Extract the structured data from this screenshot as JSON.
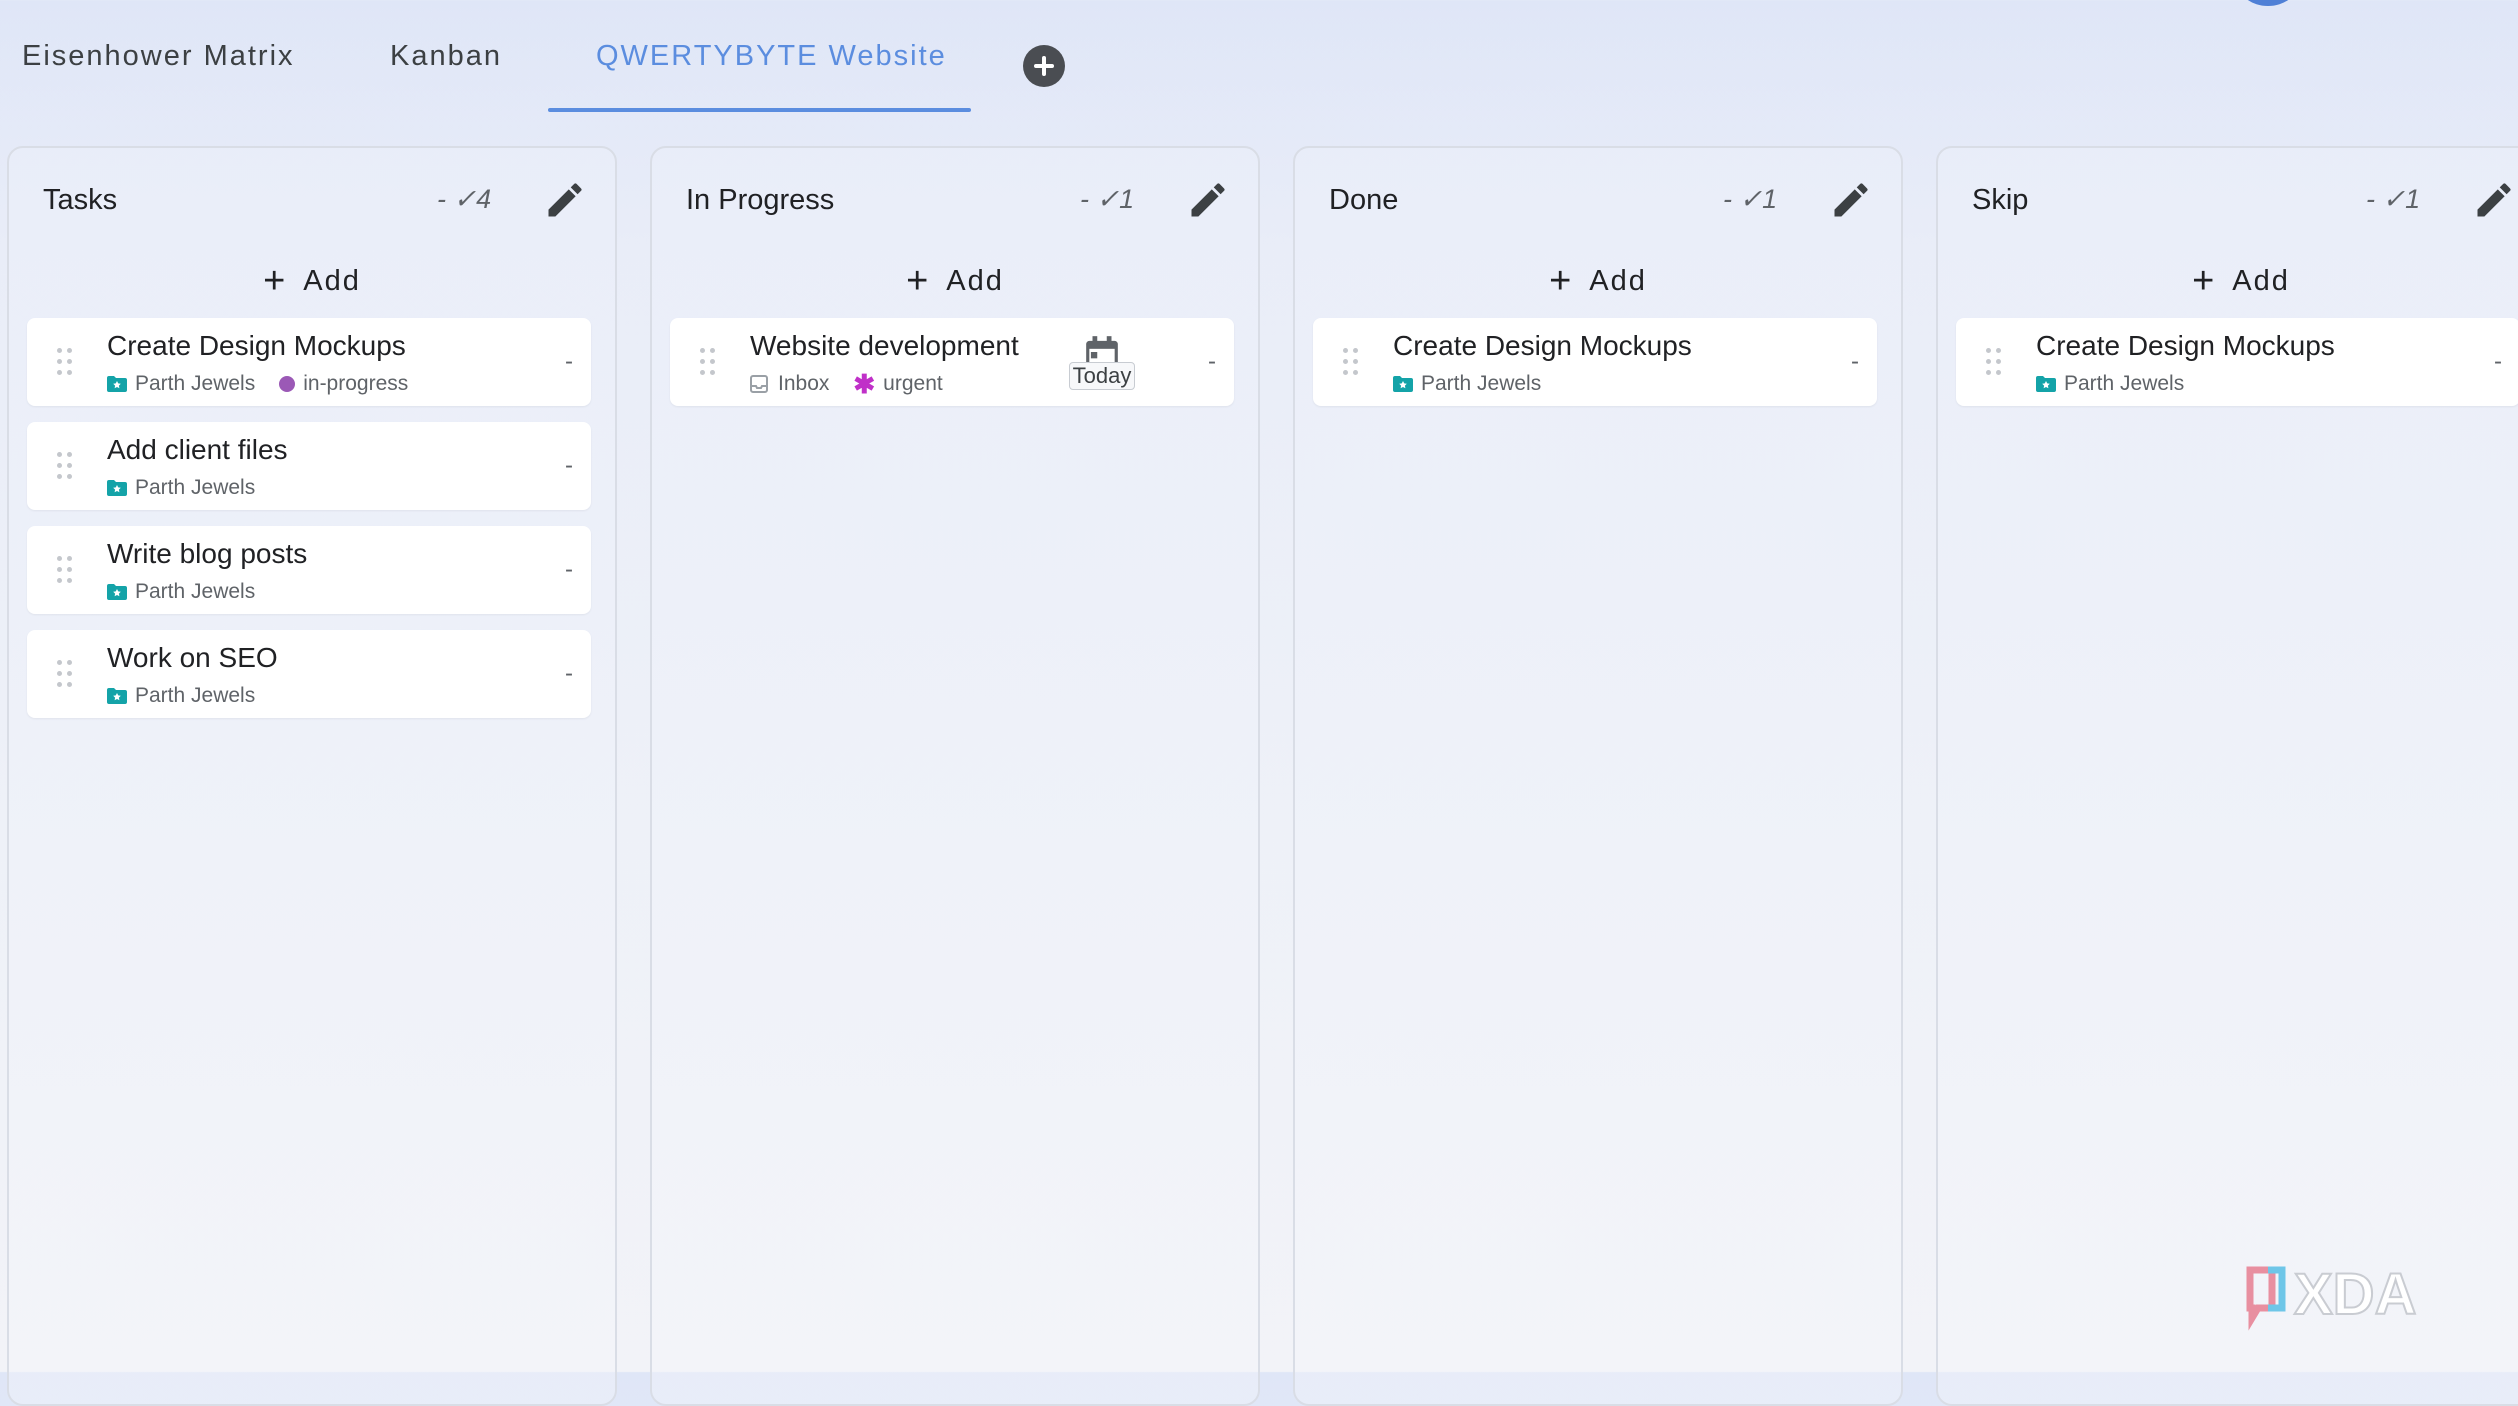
{
  "tabs": [
    {
      "label": "Eisenhower Matrix",
      "active": false
    },
    {
      "label": "Kanban",
      "active": false
    },
    {
      "label": "QWERTYBYTE Website",
      "active": true
    }
  ],
  "add_tab_icon": "plus-circle-icon",
  "colors": {
    "accent": "#5b8ddf",
    "project_folder": "#14a3a8",
    "in_progress_tag": "#9b59b6",
    "urgent_tag": "#c030c8"
  },
  "columns": [
    {
      "title": "Tasks",
      "count": "- ✓4",
      "add_label": "Add",
      "cards": [
        {
          "title": "Create Design Mockups",
          "project": "Parth Jewels",
          "tag": "in-progress",
          "action": "-"
        },
        {
          "title": "Add client files",
          "project": "Parth Jewels",
          "action": "-"
        },
        {
          "title": "Write blog posts",
          "project": "Parth Jewels",
          "action": "-"
        },
        {
          "title": "Work on SEO",
          "project": "Parth Jewels",
          "action": "-"
        }
      ]
    },
    {
      "title": "In Progress",
      "count": "- ✓1",
      "add_label": "Add",
      "cards": [
        {
          "title": "Website development",
          "project": "Inbox",
          "tag": "urgent",
          "due": "Today",
          "action": "-"
        }
      ]
    },
    {
      "title": "Done",
      "count": "- ✓1",
      "add_label": "Add",
      "cards": [
        {
          "title": "Create Design Mockups",
          "project": "Parth Jewels",
          "action": "-"
        }
      ]
    },
    {
      "title": "Skip",
      "count": "- ✓1",
      "add_label": "Add",
      "cards": [
        {
          "title": "Create Design Mockups",
          "project": "Parth Jewels",
          "action": "-"
        }
      ]
    }
  ],
  "watermark": "XDA"
}
